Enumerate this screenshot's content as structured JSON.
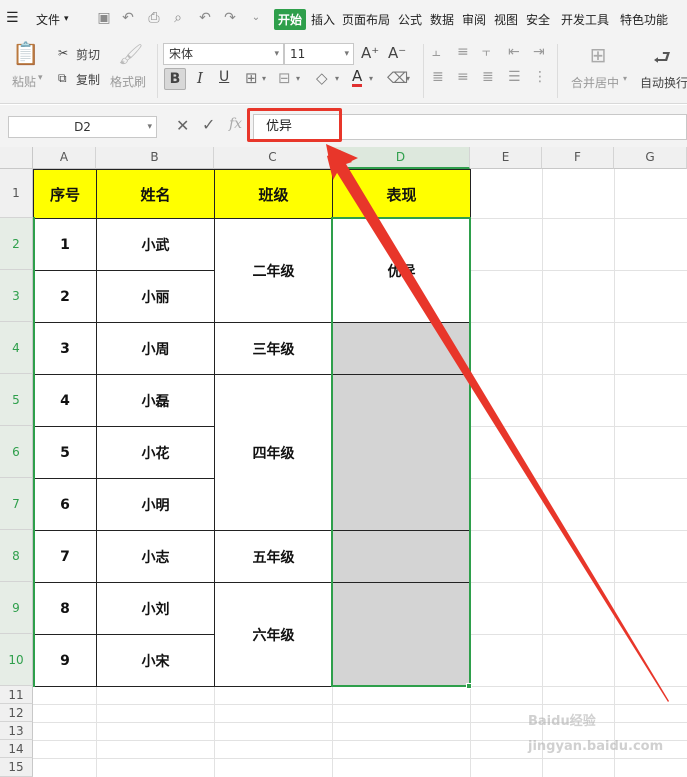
{
  "menu": {
    "file": "文件",
    "tabs": [
      "开始",
      "插入",
      "页面布局",
      "公式",
      "数据",
      "审阅",
      "视图",
      "安全",
      "开发工具",
      "特色功能"
    ],
    "active_tab": "开始"
  },
  "ribbon": {
    "paste": "粘贴",
    "cut": "剪切",
    "copy": "复制",
    "format_painter": "格式刷",
    "font_name": "宋体",
    "font_size": "11",
    "bold": "B",
    "italic": "I",
    "underline": "U",
    "font_color_letter": "A",
    "merge_center": "合并居中",
    "wrap_text": "自动换行"
  },
  "formula_bar": {
    "name_box": "D2",
    "fx": "fx",
    "content": "优异"
  },
  "columns": [
    "A",
    "B",
    "C",
    "D",
    "E",
    "F",
    "G"
  ],
  "selected_column": "D",
  "rows": [
    "1",
    "2",
    "3",
    "4",
    "5",
    "6",
    "7",
    "8",
    "9",
    "10",
    "11",
    "12",
    "13",
    "14",
    "15"
  ],
  "table": {
    "headers": [
      "序号",
      "姓名",
      "班级",
      "表现"
    ],
    "ids": [
      "1",
      "2",
      "3",
      "4",
      "5",
      "6",
      "7",
      "8",
      "9"
    ],
    "names": [
      "小武",
      "小丽",
      "小周",
      "小磊",
      "小花",
      "小明",
      "小志",
      "小刘",
      "小宋"
    ],
    "classes": [
      "二年级",
      "三年级",
      "四年级",
      "五年级",
      "六年级"
    ],
    "performance": "优异"
  },
  "colors": {
    "header_fill": "#ffff00",
    "selection_green": "#2e9f4b",
    "filled_grey": "#d4d4d4",
    "annotation_red": "#e8362a"
  },
  "watermark": "Baidu经验 jingyan.baidu.com"
}
